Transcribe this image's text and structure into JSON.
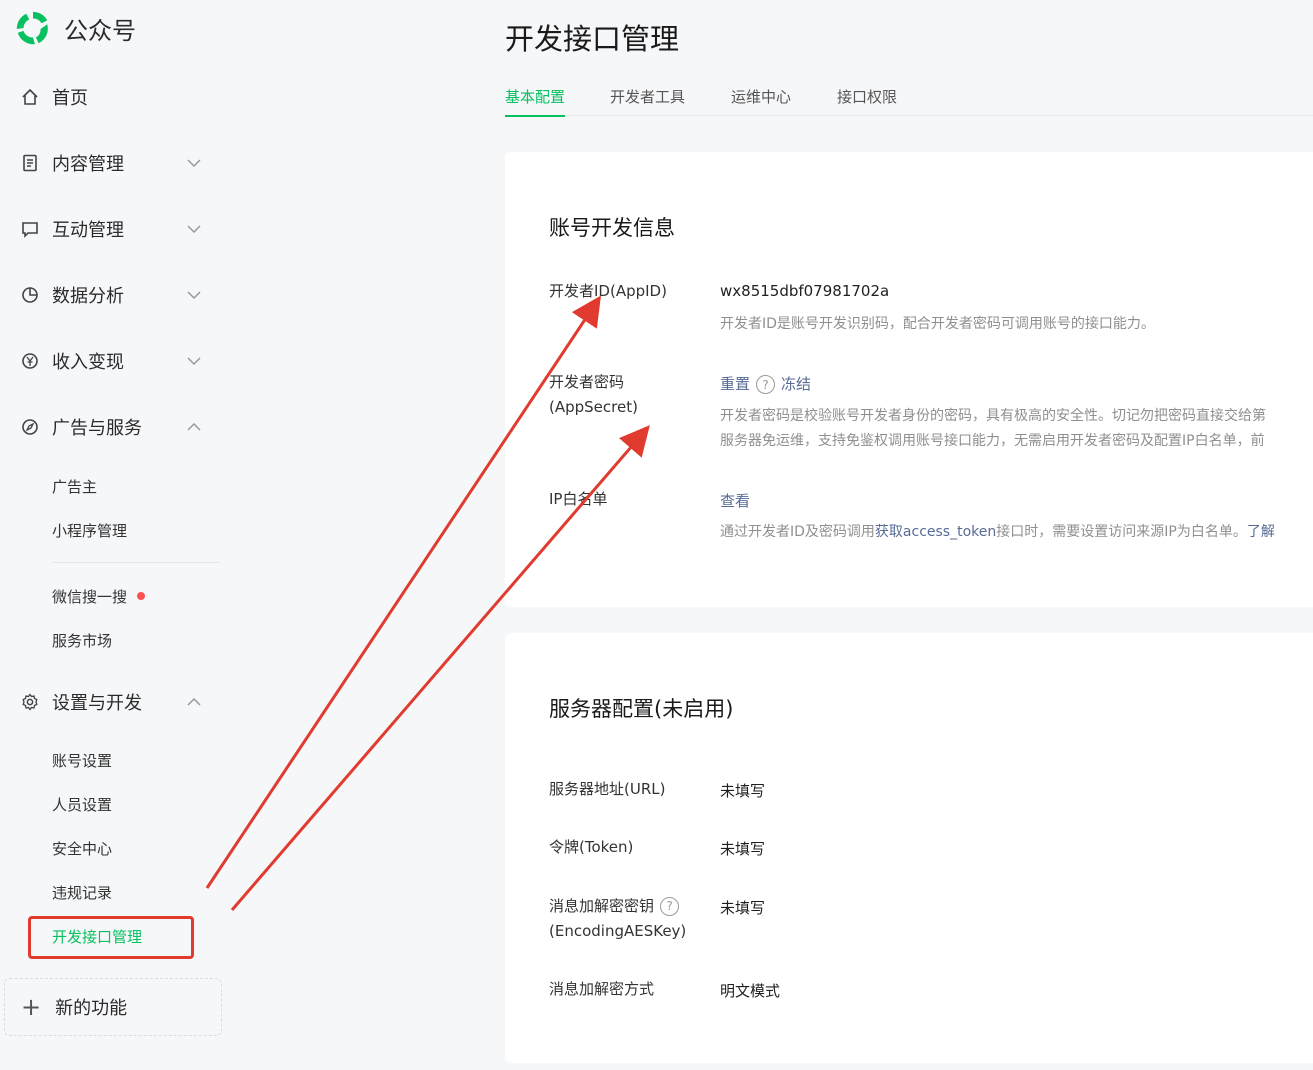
{
  "brand": {
    "name": "公众号"
  },
  "sidebar": {
    "items": [
      {
        "label": "首页"
      },
      {
        "label": "内容管理"
      },
      {
        "label": "互动管理"
      },
      {
        "label": "数据分析"
      },
      {
        "label": "收入变现"
      },
      {
        "label": "广告与服务"
      },
      {
        "label": "设置与开发"
      }
    ],
    "ads_sub": [
      "广告主",
      "小程序管理",
      "微信搜一搜",
      "服务市场"
    ],
    "settings_sub": [
      "账号设置",
      "人员设置",
      "安全中心",
      "违规记录",
      "开发接口管理"
    ],
    "new_feature": "新的功能"
  },
  "main": {
    "title": "开发接口管理",
    "tabs": [
      "基本配置",
      "开发者工具",
      "运维中心",
      "接口权限"
    ]
  },
  "dev_info": {
    "title": "账号开发信息",
    "appid_label": "开发者ID(AppID)",
    "appid_value": "wx8515dbf07981702a",
    "appid_desc": "开发者ID是账号开发识别码，配合开发者密码可调用账号的接口能力。",
    "secret_label": "开发者密码(AppSecret)",
    "secret_reset": "重置",
    "secret_freeze": "冻结",
    "secret_desc1": "开发者密码是校验账号开发者身份的密码，具有极高的安全性。切记勿把密码直接交给第",
    "secret_desc2": "服务器免运维，支持免鉴权调用账号接口能力，无需启用开发者密码及配置IP白名单，前",
    "ip_label": "IP白名单",
    "ip_view": "查看",
    "ip_desc_prefix": "通过开发者ID及密码调用",
    "ip_desc_link": "获取access_token",
    "ip_desc_suffix": "接口时，需要设置访问来源IP为白名单。",
    "ip_desc_more": "了解"
  },
  "server_config": {
    "title": "服务器配置(未启用)",
    "url_label": "服务器地址(URL)",
    "url_value": "未填写",
    "token_label": "令牌(Token)",
    "token_value": "未填写",
    "aes_label1": "消息加解密密钥",
    "aes_label2": "(EncodingAESKey)",
    "aes_value": "未填写",
    "mode_label": "消息加解密方式",
    "mode_value": "明文模式"
  },
  "colors": {
    "accent": "#07c160",
    "link": "#576b95",
    "annotation": "#e03b2e",
    "badge": "#fa5151"
  },
  "icons": [
    "home-icon",
    "document-icon",
    "chat-icon",
    "pie-chart-icon",
    "yen-icon",
    "compass-icon",
    "gear-icon",
    "plus-icon"
  ]
}
